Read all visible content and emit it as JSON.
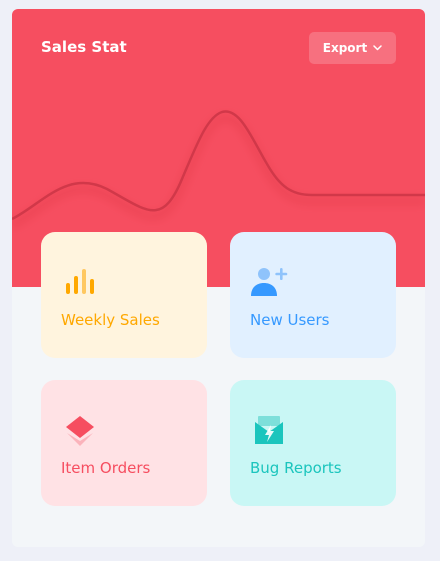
{
  "widget": {
    "title": "Sales Stat",
    "export_label": "Export",
    "accent_color": "#f64e60"
  },
  "tiles": [
    {
      "label": "Weekly Sales",
      "icon": "bar-chart-icon",
      "color": "#ffa800",
      "background": "#fff4de"
    },
    {
      "label": "New Users",
      "icon": "add-user-icon",
      "color": "#3699ff",
      "background": "#e1f0ff"
    },
    {
      "label": "Item Orders",
      "icon": "layers-icon",
      "color": "#f64e60",
      "background": "#ffe2e5"
    },
    {
      "label": "Bug Reports",
      "icon": "mail-bolt-icon",
      "color": "#1bc5bd",
      "background": "#c9f7f5"
    }
  ]
}
